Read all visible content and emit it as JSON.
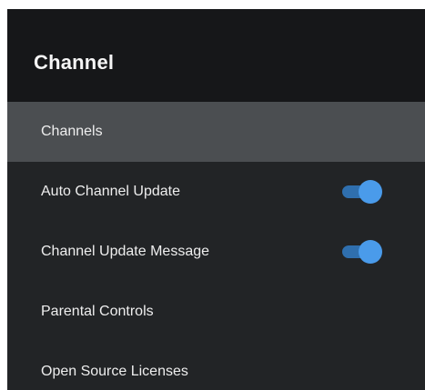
{
  "header": {
    "title": "Channel"
  },
  "menu": {
    "items": [
      {
        "label": "Channels",
        "selected": true
      },
      {
        "label": "Auto Channel Update",
        "toggle": "on"
      },
      {
        "label": "Channel Update Message",
        "toggle": "on"
      },
      {
        "label": "Parental Controls"
      },
      {
        "label": "Open Source Licenses"
      }
    ]
  },
  "colors": {
    "header_bg": "#161719",
    "panel_bg": "#222426",
    "selected_bg": "#4b4e51",
    "toggle_accent": "#4a9bea"
  }
}
